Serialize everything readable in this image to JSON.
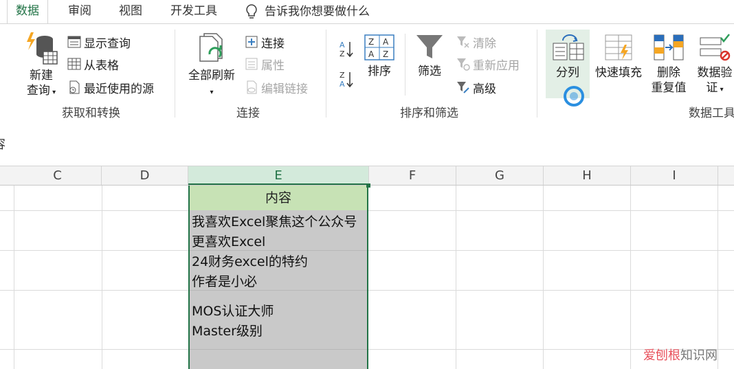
{
  "tabs": {
    "data": "数据",
    "review": "审阅",
    "view": "视图",
    "developer": "开发工具",
    "tellme": "告诉我你想要做什么"
  },
  "ribbon": {
    "get_transform": {
      "new_query_line1": "新建",
      "new_query_line2": "查询",
      "show_queries": "显示查询",
      "from_table": "从表格",
      "recent_sources": "最近使用的源",
      "label": "获取和转换"
    },
    "connections": {
      "refresh_all": "全部刷新",
      "connections": "连接",
      "properties": "属性",
      "edit_links": "编辑链接",
      "label": "连接"
    },
    "sort_filter": {
      "sort": "排序",
      "filter": "筛选",
      "clear": "清除",
      "reapply": "重新应用",
      "advanced": "高级",
      "label": "排序和筛选"
    },
    "data_tools": {
      "text_to_columns": "分列",
      "flash_fill": "快速填充",
      "remove_dup_line1": "删除",
      "remove_dup_line2": "重复值",
      "validation_line1": "数据验",
      "validation_line2": "证",
      "label": "数据工具"
    }
  },
  "formula_bar": {
    "content_fragment": "容"
  },
  "columns": [
    "C",
    "D",
    "E",
    "F",
    "G",
    "H",
    "I"
  ],
  "sheet": {
    "header": "内容",
    "lines": [
      "我喜欢Excel聚焦这个公众号",
      "更喜欢Excel",
      "24财务excel的特约",
      "作者是小必",
      "MOS认证大师",
      "Master级别"
    ]
  },
  "watermark": {
    "brand": "爱刨根",
    "suffix": "知识网"
  },
  "colors": {
    "accent": "#217346",
    "selected_fill": "#c9c9c9",
    "header_fill": "#c7e2b5"
  }
}
